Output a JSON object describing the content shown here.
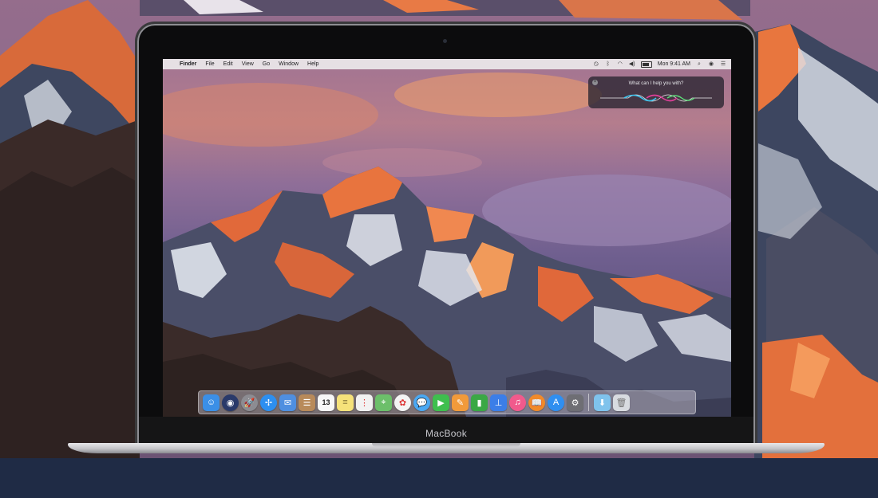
{
  "menu_bar": {
    "apple_glyph": "",
    "items": [
      "Finder",
      "File",
      "Edit",
      "View",
      "Go",
      "Window",
      "Help"
    ],
    "status_icons": [
      "time-machine-icon",
      "bluetooth-icon",
      "wifi-icon",
      "volume-icon",
      "battery-icon"
    ],
    "clock": "Mon 9:41 AM",
    "right_icons": [
      "spotlight-icon",
      "siri-icon",
      "notification-center-icon"
    ]
  },
  "siri": {
    "prompt": "What can I help you with?",
    "close_glyph": "×",
    "wave_colors": [
      "#3ec6f0",
      "#e0409a",
      "#5ee07a",
      "#ffffff"
    ]
  },
  "dock": {
    "apps": [
      {
        "name": "Finder",
        "icon": "finder-icon",
        "glyph": "☺",
        "color": "#3b8fe6"
      },
      {
        "name": "Siri",
        "icon": "siri-icon",
        "glyph": "◉",
        "color": "#2a3a6a"
      },
      {
        "name": "Launchpad",
        "icon": "launchpad-icon",
        "glyph": "🚀",
        "color": "#8c8c92"
      },
      {
        "name": "Safari",
        "icon": "safari-icon",
        "glyph": "✢",
        "color": "#2d8ff0"
      },
      {
        "name": "Mail",
        "icon": "mail-icon",
        "glyph": "✉",
        "color": "#4f8fe0"
      },
      {
        "name": "Contacts",
        "icon": "contacts-icon",
        "glyph": "☰",
        "color": "#b88a5a"
      },
      {
        "name": "Calendar",
        "icon": "calendar-icon",
        "glyph": "13",
        "color": "#f7f7f7"
      },
      {
        "name": "Notes",
        "icon": "notes-icon",
        "glyph": "≡",
        "color": "#f6e27a"
      },
      {
        "name": "Reminders",
        "icon": "reminders-icon",
        "glyph": "⋮",
        "color": "#f2f2f2"
      },
      {
        "name": "Maps",
        "icon": "maps-icon",
        "glyph": "⌖",
        "color": "#6cbf6a"
      },
      {
        "name": "Photos",
        "icon": "photos-icon",
        "glyph": "✿",
        "color": "#f4f4f4"
      },
      {
        "name": "Messages",
        "icon": "messages-icon",
        "glyph": "💬",
        "color": "#4aa8f2"
      },
      {
        "name": "FaceTime",
        "icon": "facetime-icon",
        "glyph": "▶",
        "color": "#3fbf4e"
      },
      {
        "name": "Pages",
        "icon": "pages-icon",
        "glyph": "✎",
        "color": "#f19a3a"
      },
      {
        "name": "Numbers",
        "icon": "numbers-icon",
        "glyph": "▮",
        "color": "#3aa845"
      },
      {
        "name": "Keynote",
        "icon": "keynote-icon",
        "glyph": "⊥",
        "color": "#3b7ee8"
      },
      {
        "name": "iTunes",
        "icon": "itunes-icon",
        "glyph": "♫",
        "color": "#f05a8c"
      },
      {
        "name": "iBooks",
        "icon": "ibooks-icon",
        "glyph": "📖",
        "color": "#f08a2a"
      },
      {
        "name": "App Store",
        "icon": "app-store-icon",
        "glyph": "A",
        "color": "#2f8ff0"
      },
      {
        "name": "System Preferences",
        "icon": "system-preferences-icon",
        "glyph": "⚙",
        "color": "#6e6e74"
      }
    ],
    "stack": [
      {
        "name": "Downloads",
        "icon": "downloads-folder-icon",
        "glyph": "⬇",
        "color": "#7fc3ec"
      },
      {
        "name": "Trash",
        "icon": "trash-icon",
        "glyph": "🗑",
        "color": "#d8dbe0"
      }
    ]
  },
  "laptop": {
    "brand": "MacBook"
  },
  "colors": {
    "footer_band": "#1f2b45",
    "bezel": "#0c0c0d",
    "aluminum": "#c4c4c8"
  }
}
